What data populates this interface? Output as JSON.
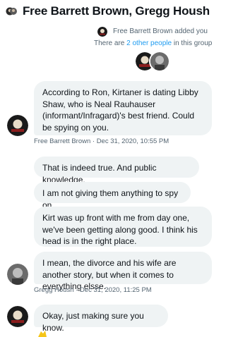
{
  "header": {
    "title": "Free Barrett Brown, Gregg Housh"
  },
  "system": {
    "added_text": "Free Barrett Brown added you",
    "others_prefix": "There are ",
    "others_link": "2 other people",
    "others_suffix": " in this group"
  },
  "messages": [
    {
      "sender": "Free Barrett Brown",
      "text": "According to Ron, Kirtaner is dating Libby Shaw, who is Neal Rauhauser (informant/Infragard)'s best friend. Could be spying on you."
    },
    {
      "text": "That is indeed true. And public knowledge."
    },
    {
      "text": "I am not giving them anything to spy on."
    },
    {
      "text": "Kirt was up front with me from day one, we've been getting along good. I think his head is in the right place."
    },
    {
      "text": "I mean, the divorce and his wife are another story, but when it comes to everything elsse."
    },
    {
      "text": "Okay, just making sure you know."
    }
  ],
  "meta": {
    "fbb": "Free Barrett Brown · Dec 31, 2020, 10:55 PM",
    "gregg": "Gregg Housh · Dec 31, 2020, 11:25 PM"
  },
  "colors": {
    "bubble": "#eff3f4",
    "text": "#0f1419",
    "muted": "#536471",
    "link": "#1d9bf0"
  },
  "icons": [
    "group-icon",
    "fbb-avatar",
    "gregg-avatar",
    "emoji-icon"
  ]
}
